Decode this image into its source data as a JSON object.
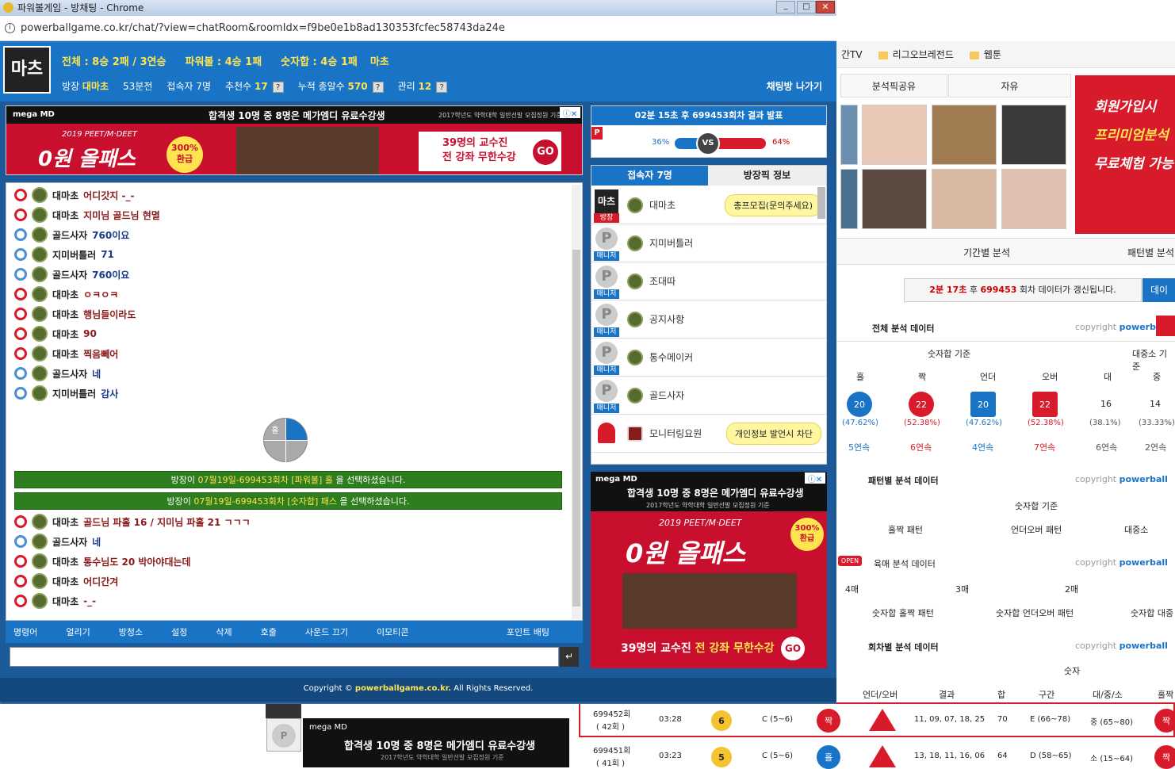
{
  "window": {
    "title": "파워볼게임 - 방채팅 - Chrome",
    "url": "powerballgame.co.kr/chat/?view=chatRoom&roomIdx=f9be0e1b8ad130353fcfec58743da24e"
  },
  "room": {
    "logo_text": "마츠",
    "stats": {
      "total": "전체 : 8승 2패 / 3연승",
      "powerball": "파워볼 : 4승 1패",
      "numsum": "숫자합 : 4승 1패",
      "owner": "마초"
    },
    "sub": {
      "owner_label": "방장",
      "owner_name": "대마초",
      "minutes": "53분전",
      "users": "접속자 7명",
      "recommend_label": "추천수",
      "recommend": "17",
      "acc_label": "누적 총알수",
      "acc": "570",
      "manage_label": "관리",
      "manage": "12"
    },
    "leave": "채팅방 나가기"
  },
  "ad_top": {
    "brand": "mega MD",
    "headline": "합격생 10명 중 8명은 메가엠디 유료수강생",
    "note": "2017학년도 약학대학 일반선발 모집정원 기준",
    "badge": "2019 PEET/M·DEET",
    "big": "0원 올패스",
    "refund": "300% 환급",
    "cta1": "39명의 교수진",
    "cta2": "전 강좌 무한수강",
    "go": "GO"
  },
  "result": {
    "title": "02분 15초 후 699453회차 결과 발표",
    "left_pct": "36%",
    "vs": "VS",
    "right_pct": "64%",
    "p": "P"
  },
  "user_tabs": [
    "접속자 7명",
    "방장픽 정보"
  ],
  "users": [
    {
      "name": "대마초",
      "tag": "방장",
      "bubble": "총프모집(문의주세요)"
    },
    {
      "name": "지미버틀러",
      "tag": "매니저"
    },
    {
      "name": "조대따",
      "tag": "매니저"
    },
    {
      "name": "공지사항",
      "tag": "매니저"
    },
    {
      "name": "통수메이커",
      "tag": "매니저"
    },
    {
      "name": "골드사자",
      "tag": "매니저"
    },
    {
      "name": "모니터링요원",
      "bubble": "개인정보 발언시 차단"
    }
  ],
  "messages": [
    {
      "name": "대마초",
      "text": "어디갓지 -_-",
      "color": "#8b1a1a"
    },
    {
      "name": "대마초",
      "text": "지미님 골드님 현멸",
      "color": "#8b1a1a"
    },
    {
      "name": "골드사자",
      "text": "760이요",
      "color": "#1a3a8b"
    },
    {
      "name": "지미버틀러",
      "text": "71",
      "color": "#1a3a8b"
    },
    {
      "name": "골드사자",
      "text": "760이요",
      "color": "#1a3a8b"
    },
    {
      "name": "대마초",
      "text": "ㅇㅋㅇㅋ",
      "color": "#8b1a1a"
    },
    {
      "name": "대마초",
      "text": "행님들이라도",
      "color": "#8b1a1a"
    },
    {
      "name": "대마초",
      "text": "90",
      "color": "#8b1a1a"
    },
    {
      "name": "대마초",
      "text": "찍음뻬어",
      "color": "#8b1a1a"
    },
    {
      "name": "골드사자",
      "text": "네",
      "color": "#1a3a8b"
    },
    {
      "name": "지미버틀러",
      "text": "감사",
      "color": "#1a3a8b"
    }
  ],
  "pick": {
    "label": "홀"
  },
  "system": [
    {
      "pre": "방장이 ",
      "date": "07월19일-699453회차",
      "mid": " [파워볼] 홀 ",
      "post": "을 선택하셨습니다."
    },
    {
      "pre": "방장이 ",
      "date": "07월19일-699453회차",
      "mid": " [숫자합] 패스 ",
      "post": "을 선택하셨습니다."
    }
  ],
  "messages2": [
    {
      "name": "대마초",
      "text": "골드님 파홀 16 / 지미님 파홀 21 ㄱㄱㄱ",
      "color": "#8b1a1a"
    },
    {
      "name": "골드사자",
      "text": "네",
      "color": "#1a3a8b"
    },
    {
      "name": "대마초",
      "text": "통수님도 20 박아야대는데",
      "color": "#8b1a1a"
    },
    {
      "name": "대마초",
      "text": "어디간겨",
      "color": "#8b1a1a"
    },
    {
      "name": "대마초",
      "text": "-_-",
      "color": "#8b1a1a"
    }
  ],
  "menu": [
    "명령어",
    "얼리기",
    "방청소",
    "설정",
    "삭제",
    "호출",
    "사운드 끄기",
    "이모티콘"
  ],
  "menu_right": "포인트 배팅",
  "send": "↵",
  "copyright_pre": "Copyright © ",
  "copyright_site": "powerballgame.co.kr.",
  "copyright_post": " All Rights Reserved.",
  "bg": {
    "bookmarks": [
      "간TV",
      "리그오브레전드",
      "웹툰"
    ],
    "tabs": [
      "분석픽공유",
      "자유"
    ],
    "ad": [
      "회원가입시",
      "프리미엄분석",
      "무료체험 가능"
    ],
    "nav": [
      "기간별 분석",
      "패턴별 분석"
    ],
    "update_time": "2분 17초",
    "update_round": "699453",
    "update_text": "회차 데이터가 갱신됩니다.",
    "update_btn": "데이터",
    "sec1": "전체 분석 데이터",
    "copyright": "copyright",
    "brand": "powerball",
    "numsum_basis": "숫자합 기준",
    "ds_basis": "대중소 기준",
    "cols": [
      "홀",
      "짝",
      "언더",
      "오버",
      "대",
      "중"
    ],
    "vals": [
      "20",
      "22",
      "20",
      "22",
      "16",
      "14"
    ],
    "pcts": [
      "(47.62%)",
      "(52.38%)",
      "(47.62%)",
      "(52.38%)",
      "(38.1%)",
      "(33.33%)"
    ],
    "streaks": [
      "5연속",
      "6연속",
      "4연속",
      "7연속",
      "6연속",
      "2연속"
    ],
    "sec2": "패턴별 분석 데이터",
    "pat": [
      "홀짝 패턴",
      "언더오버 패턴",
      "대중소"
    ],
    "open": "OPEN",
    "sec3": "육매 분석 데이터",
    "six": [
      "4매",
      "3매",
      "2매"
    ],
    "six2": [
      "숫자합 홀짝 패턴",
      "숫자합 언더오버 패턴",
      "숫자합 대중"
    ],
    "sec4": "회차별 분석 데이터",
    "numcol": "숫자",
    "rcols": [
      "언더/오버",
      "결과",
      "합",
      "구간",
      "대/중/소",
      "홀짝"
    ],
    "rows": [
      {
        "round": "699452회",
        "sub": "( 42회 )",
        "time": "03:28",
        "ball": "6",
        "sec": "C (5~6)",
        "oe": "짝",
        "res": "11, 09, 07, 18, 25",
        "sum": "70",
        "range": "E (66~78)",
        "size": "중 (65~80)",
        "oe2": "짝"
      },
      {
        "round": "699451회",
        "sub": "( 41회 )",
        "time": "03:23",
        "ball": "5",
        "sec": "C (5~6)",
        "oe": "홀",
        "res": "13, 18, 11, 16, 06",
        "sum": "64",
        "range": "D (58~65)",
        "size": "소 (15~64)",
        "oe2": "짝"
      }
    ]
  }
}
